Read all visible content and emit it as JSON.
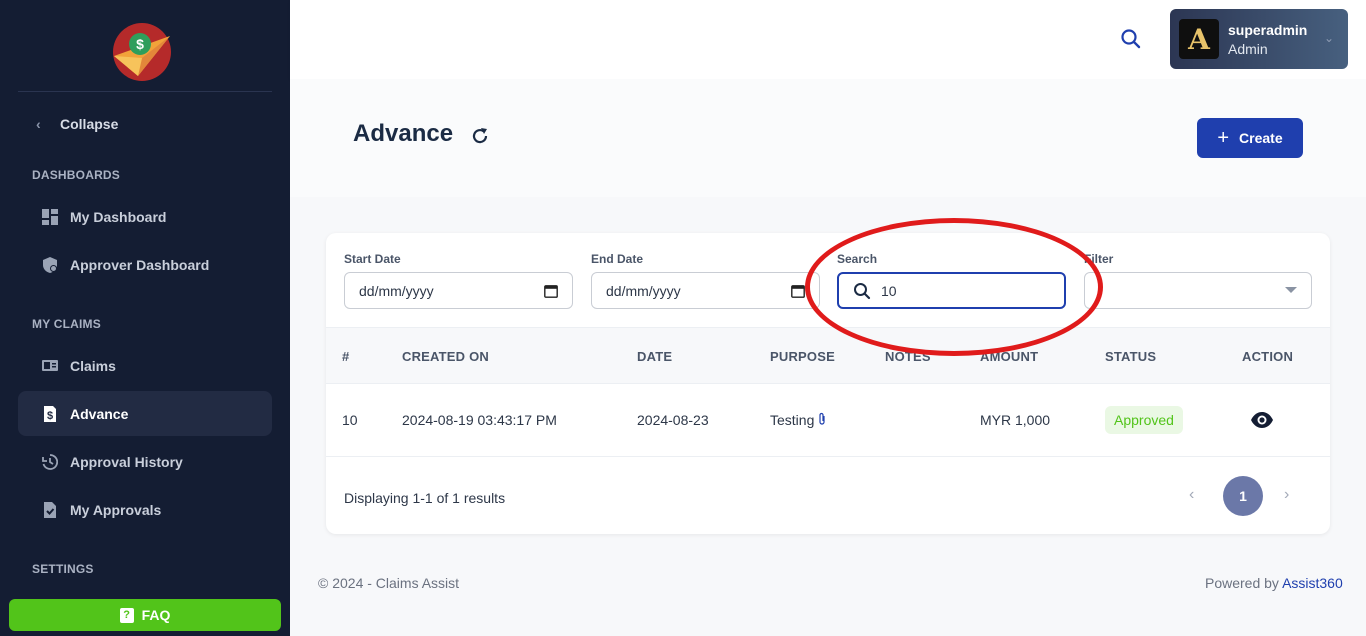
{
  "sidebar": {
    "collapse_label": "Collapse",
    "sections": {
      "dashboards": "DASHBOARDS",
      "my_claims": "MY CLAIMS",
      "settings": "SETTINGS"
    },
    "items": {
      "my_dashboard": "My Dashboard",
      "approver_dashboard": "Approver Dashboard",
      "claims": "Claims",
      "advance": "Advance",
      "approval_history": "Approval History",
      "my_approvals": "My Approvals"
    },
    "faq_label": "FAQ"
  },
  "topbar": {
    "user_name": "superadmin",
    "user_role": "Admin",
    "avatar_letter": "A"
  },
  "page": {
    "title": "Advance",
    "create_label": "Create"
  },
  "filters": {
    "start_date_label": "Start Date",
    "start_date_value": "dd/mm/yyyy",
    "end_date_label": "End Date",
    "end_date_value": "dd/mm/yyyy",
    "search_label": "Search",
    "search_value": "10",
    "filter_label": "Filter",
    "filter_value": ""
  },
  "table": {
    "headers": [
      "#",
      "CREATED ON",
      "DATE",
      "PURPOSE",
      "NOTES",
      "AMOUNT",
      "STATUS",
      "ACTION"
    ],
    "rows": [
      {
        "id": "10",
        "created_on": "2024-08-19 03:43:17 PM",
        "date": "2024-08-23",
        "purpose": "Testing",
        "notes": "",
        "amount": "MYR 1,000",
        "status": "Approved"
      }
    ]
  },
  "pagination": {
    "results_text": "Displaying 1-1 of 1 results",
    "current_page": "1"
  },
  "footer": {
    "copyright": "© 2024 - Claims Assist",
    "powered_prefix": "Powered by ",
    "powered_link": "Assist360"
  },
  "colors": {
    "sidebar_bg": "#141d33",
    "primary": "#1f3fae",
    "success": "#52c41a",
    "annotation": "#e01b1b"
  }
}
